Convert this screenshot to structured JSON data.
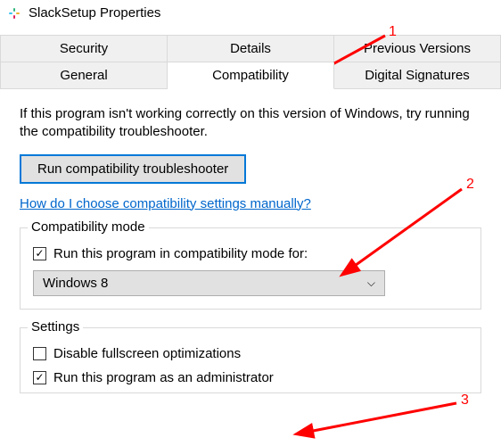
{
  "window": {
    "title": "SlackSetup Properties"
  },
  "tabs": {
    "row1": [
      "Security",
      "Details",
      "Previous Versions"
    ],
    "row2": [
      "General",
      "Compatibility",
      "Digital Signatures"
    ],
    "active": "Compatibility"
  },
  "intro": "If this program isn't working correctly on this version of Windows, try running the compatibility troubleshooter.",
  "run_button": "Run compatibility troubleshooter",
  "help_link": "How do I choose compatibility settings manually?",
  "compat_group": {
    "label": "Compatibility mode",
    "checkbox": {
      "checked": true,
      "label": "Run this program in compatibility mode for:"
    },
    "select": {
      "value": "Windows 8"
    }
  },
  "settings_group": {
    "label": "Settings",
    "disable_fullscreen": {
      "checked": false,
      "label": "Disable fullscreen optimizations"
    },
    "run_admin": {
      "checked": true,
      "label": "Run this program as an administrator"
    }
  },
  "annotations": {
    "n1": "1",
    "n2": "2",
    "n3": "3"
  }
}
